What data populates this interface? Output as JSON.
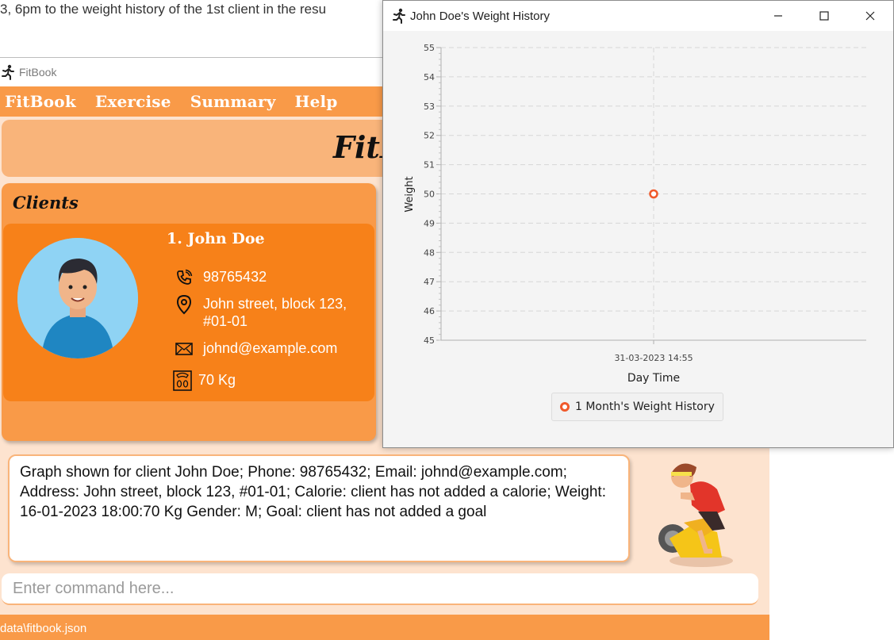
{
  "background": {
    "text": "3, 6pm to the weight history of the 1st client in the resu"
  },
  "fitbook": {
    "window_title": "FitBook",
    "menu": [
      "FitBook",
      "Exercise",
      "Summary",
      "Help"
    ],
    "banner_title": "FitB",
    "clients_heading": "Clients",
    "client": {
      "name": "1.  John Doe",
      "phone": "98765432",
      "address": "John street, block 123, #01-01",
      "email": "johnd@example.com",
      "weight": "70 Kg"
    },
    "result_text": "Graph shown for client John Doe; Phone: 98765432; Email: johnd@example.com; Address: John street, block 123, #01-01; Calorie: client has not added a calorie; Weight: 16-01-2023 18:00:70 Kg Gender: M; Goal: client has not added a goal",
    "command_placeholder": "Enter command here...",
    "status_path": "data\\fitbook.json",
    "colors": {
      "menubar": "#f99a48",
      "card": "#f78119",
      "banner": "#f9b47a"
    }
  },
  "weight_window": {
    "title": "John Doe's Weight History",
    "legend": "1 Month's Weight History"
  },
  "chart_data": {
    "type": "scatter",
    "xlabel": "Day Time",
    "ylabel": "Weight",
    "ylim": [
      45,
      55
    ],
    "yticks": [
      "55",
      "54",
      "53",
      "52",
      "51",
      "50",
      "49",
      "48",
      "47",
      "46",
      "45"
    ],
    "xticks": [
      "31-03-2023 14:55"
    ],
    "series": [
      {
        "name": "1 Month's Weight History",
        "points": [
          {
            "x": "31-03-2023 14:55",
            "y": 50
          }
        ],
        "color": "#f0592b"
      }
    ],
    "grid": true,
    "legend_position": "bottom"
  }
}
